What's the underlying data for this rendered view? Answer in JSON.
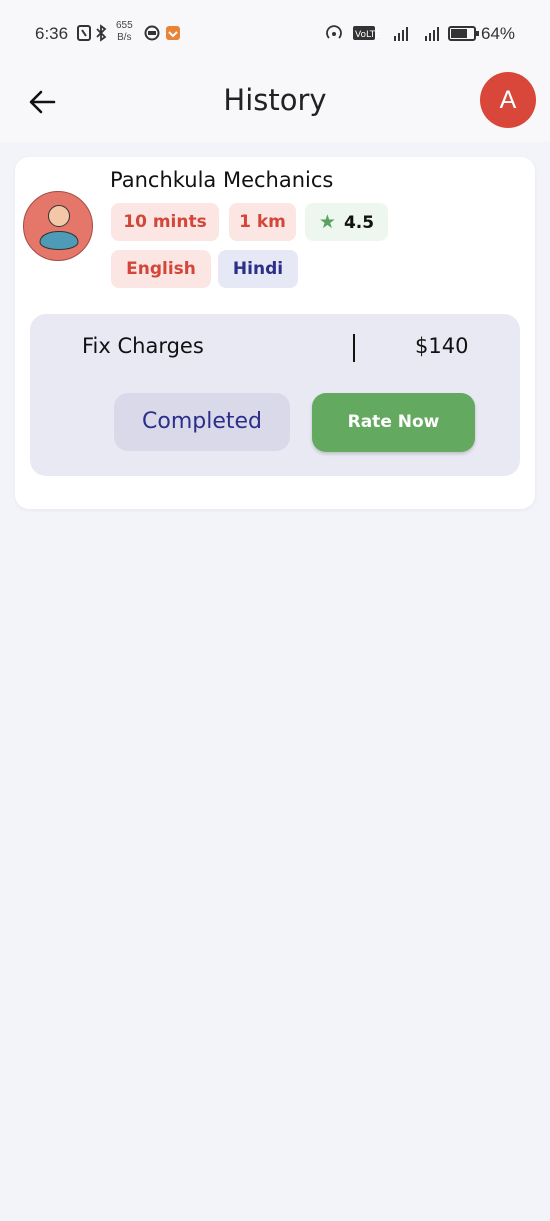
{
  "status_bar": {
    "time": "6:36",
    "net_speed_value": "655",
    "net_speed_unit": "B/s",
    "battery_percent": "64%"
  },
  "header": {
    "title": "History",
    "profile_initial": "A"
  },
  "history": [
    {
      "provider_name": "Panchkula Mechanics",
      "time_chip": "10  mints",
      "distance_chip": "1 km",
      "rating": "4.5",
      "languages": [
        "English",
        "Hindi"
      ],
      "charges_label": "Fix Charges",
      "charges_value": "$140",
      "status": "Completed",
      "action_label": "Rate Now"
    }
  ],
  "colors": {
    "background": "#f3f4f9",
    "accent_red": "#d8473a",
    "accent_green": "#63a95f",
    "accent_blue": "#2b2f8a"
  },
  "icons": {
    "back": "arrow-left-icon",
    "rating": "star-icon",
    "provider": "person-avatar-icon"
  }
}
